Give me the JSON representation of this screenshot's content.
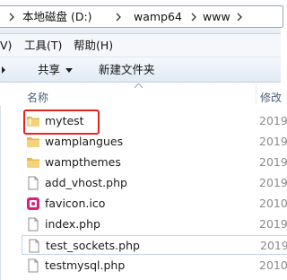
{
  "address_bar": {
    "crumbs": [
      "本地磁盘 (D:)",
      "wamp64",
      "www"
    ]
  },
  "menu": {
    "partial_view": "V)",
    "tools": "工具(T)",
    "help": "帮助(H)"
  },
  "toolbar": {
    "share": "共享",
    "new_folder": "新建文件夹"
  },
  "columns": {
    "name": "名称",
    "modified": "修改"
  },
  "files": [
    {
      "name": "mytest",
      "type": "folder",
      "date": "2019",
      "icon": "folder-icon"
    },
    {
      "name": "wamplangues",
      "type": "folder",
      "date": "2019",
      "icon": "folder-icon"
    },
    {
      "name": "wampthemes",
      "type": "folder",
      "date": "2019",
      "icon": "folder-icon"
    },
    {
      "name": "add_vhost.php",
      "type": "file",
      "date": "2019",
      "icon": "php-file-icon"
    },
    {
      "name": "favicon.ico",
      "type": "ico",
      "date": "2010",
      "icon": "favicon-icon"
    },
    {
      "name": "index.php",
      "type": "file",
      "date": "2019",
      "icon": "php-file-icon"
    },
    {
      "name": "test_sockets.php",
      "type": "file",
      "date": "2019",
      "icon": "php-file-icon"
    },
    {
      "name": "testmysql.php",
      "type": "file",
      "date": "2010",
      "icon": "php-file-icon"
    }
  ],
  "colors": {
    "highlight": "#e8221c",
    "folder": "#e8b84a",
    "favicon": "#d9207a"
  }
}
